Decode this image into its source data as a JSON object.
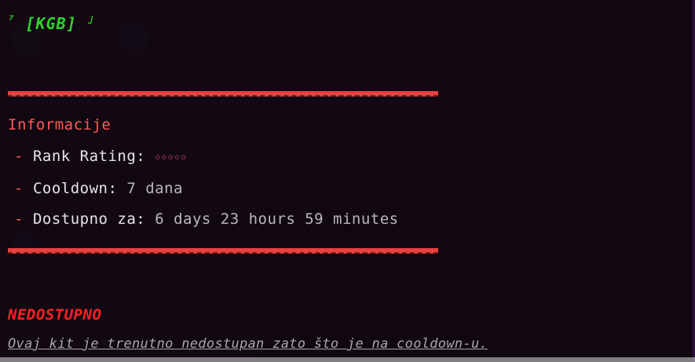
{
  "tooltip": {
    "title": "[KGB]",
    "title_prefix_symbol": "⁷",
    "title_suffix_symbol": "˩",
    "info_heading": "Informacije",
    "rows": [
      {
        "dash": "-",
        "label": "Rank Rating:",
        "value": "✩✩✩✩✩"
      },
      {
        "dash": "-",
        "label": "Cooldown:",
        "value": "7 dana"
      },
      {
        "dash": "-",
        "label": "Dostupno za:",
        "value": "6 days 23 hours 59 minutes"
      }
    ],
    "status": "NEDOSTUPNO",
    "reason": "Ovaj kit je trenutno nedostupan zato što je na cooldown-u."
  },
  "colors": {
    "title_green": "#2fd42f",
    "accent_red": "#e8413f",
    "status_red": "#ff2020"
  }
}
